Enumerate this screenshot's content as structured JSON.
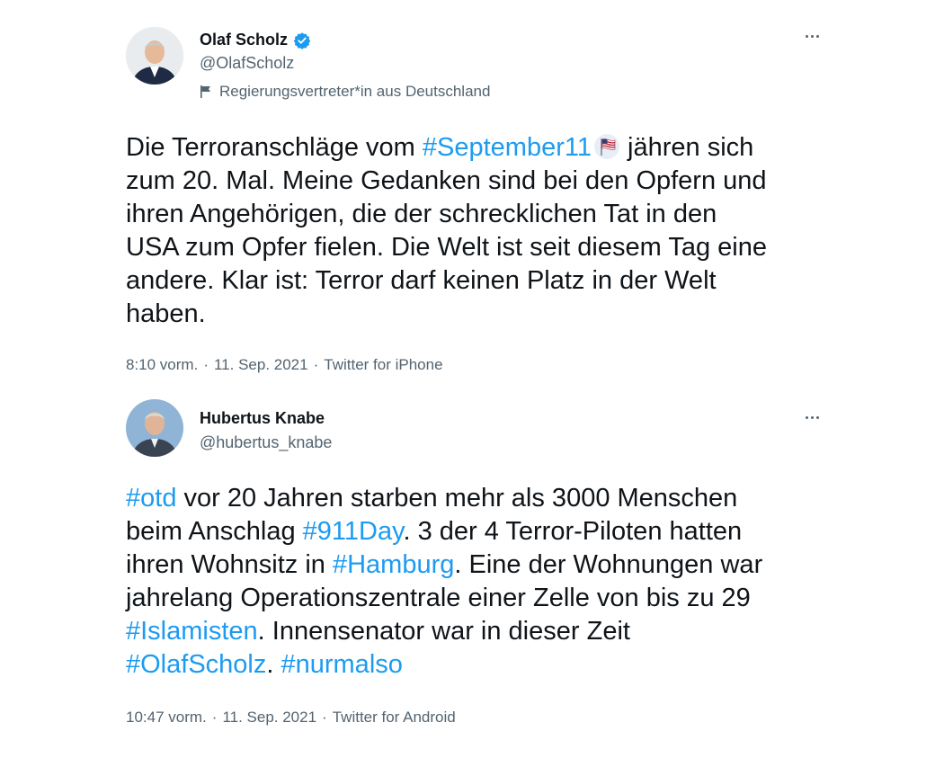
{
  "tweets": [
    {
      "name": "Olaf Scholz",
      "verified": true,
      "handle": "@OlafScholz",
      "label": "Regierungsvertreter*in aus Deutschland",
      "lines": [
        [
          {
            "t": "Die Terroranschläge vom "
          },
          {
            "t": "#September11",
            "tag": true
          },
          {
            "emoji": "us-flag-emoji-icon"
          },
          {
            "t": " jähren sich"
          }
        ],
        [
          {
            "t": "zum 20. Mal. Meine Gedanken sind bei den Opfern und"
          }
        ],
        [
          {
            "t": "ihren Angehörigen, die der schrecklichen Tat in den"
          }
        ],
        [
          {
            "t": "USA zum Opfer fielen. Die Welt ist seit diesem Tag eine"
          }
        ],
        [
          {
            "t": "andere. Klar ist: Terror darf keinen Platz in der Welt"
          }
        ],
        [
          {
            "t": "haben."
          }
        ]
      ],
      "time": "8:10 vorm.",
      "date": "11. Sep. 2021",
      "source": "Twitter for iPhone"
    },
    {
      "name": "Hubertus Knabe",
      "verified": false,
      "handle": "@hubertus_knabe",
      "lines": [
        [
          {
            "t": "#otd",
            "tag": true
          },
          {
            "t": " vor 20 Jahren starben mehr als 3000 Menschen"
          }
        ],
        [
          {
            "t": "beim Anschlag "
          },
          {
            "t": "#911Day",
            "tag": true
          },
          {
            "t": ". 3 der 4 Terror-Piloten hatten"
          }
        ],
        [
          {
            "t": "ihren Wohnsitz in "
          },
          {
            "t": "#Hamburg",
            "tag": true
          },
          {
            "t": ". Eine der  Wohnungen war"
          }
        ],
        [
          {
            "t": "jahrelang Operationszentrale einer Zelle von bis zu 29"
          }
        ],
        [
          {
            "t": "#Islamisten",
            "tag": true
          },
          {
            "t": ". Innensenator war in dieser Zeit"
          }
        ],
        [
          {
            "t": "#OlafScholz",
            "tag": true
          },
          {
            "t": ". "
          },
          {
            "t": "#nurmalso",
            "tag": true
          }
        ]
      ],
      "time": "10:47 vorm.",
      "date": "11. Sep. 2021",
      "source": "Twitter for Android"
    }
  ],
  "meta_separator": "·",
  "colors": {
    "link": "#1d9bf0",
    "secondary": "#536471",
    "text": "#0f1419"
  }
}
